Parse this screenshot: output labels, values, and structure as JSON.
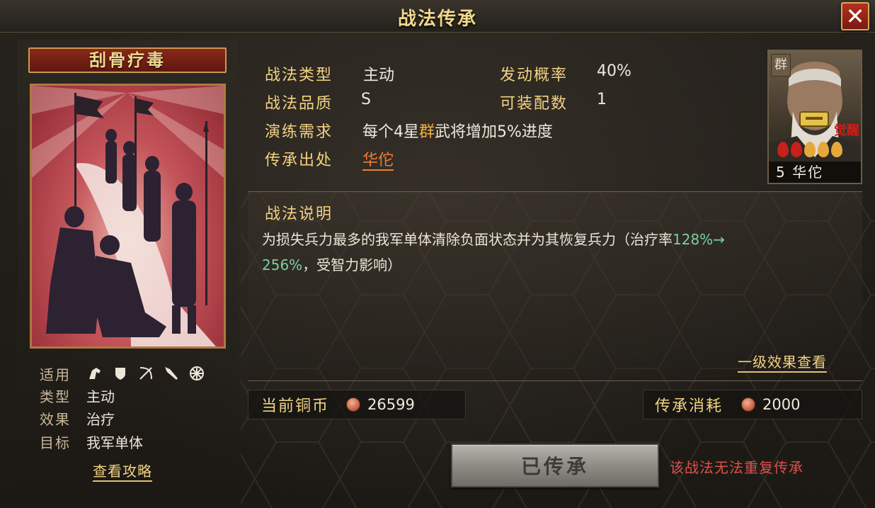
{
  "header": {
    "title": "战法传承",
    "close_label": "✕"
  },
  "skill": {
    "name": "刮骨疗毒",
    "applicable_units": [
      "cavalry-icon",
      "shield-icon",
      "bow-icon",
      "spear-icon",
      "siege-icon"
    ],
    "info": [
      {
        "key": "适用",
        "value": ""
      },
      {
        "key": "类型",
        "value": "主动"
      },
      {
        "key": "效果",
        "value": "治疗"
      },
      {
        "key": "目标",
        "value": "我军单体"
      }
    ],
    "guide_link": "查看攻略"
  },
  "stats": {
    "type_label": "战法类型",
    "type_value": "主动",
    "rate_label": "发动概率",
    "rate_value": "40%",
    "quality_label": "战法品质",
    "quality_value": "S",
    "equip_label": "可装配数",
    "equip_value": "1",
    "drill_label": "演练需求",
    "drill_prefix": "每个4星",
    "drill_faction": "群",
    "drill_suffix": "武将增加5%进度",
    "source_label": "传承出处",
    "source_value": "华佗"
  },
  "description": {
    "title": "战法说明",
    "text_1": "为损失兵力最多的我军单体清除负面状态并为其恢复兵力（治疗率",
    "green_1": "128%→",
    "green_2": "256%",
    "text_2": "，受智力影响）",
    "effect_link": "一级效果查看"
  },
  "coins": {
    "current_label": "当前铜币",
    "current_value": "26599",
    "cost_label": "传承消耗",
    "cost_value": "2000"
  },
  "action": {
    "button_label": "已传承",
    "warning": "该战法无法重复传承"
  },
  "general": {
    "faction": "群",
    "level": "5",
    "name": "华佗",
    "stars": 5,
    "awakened_label": "觉醒"
  }
}
